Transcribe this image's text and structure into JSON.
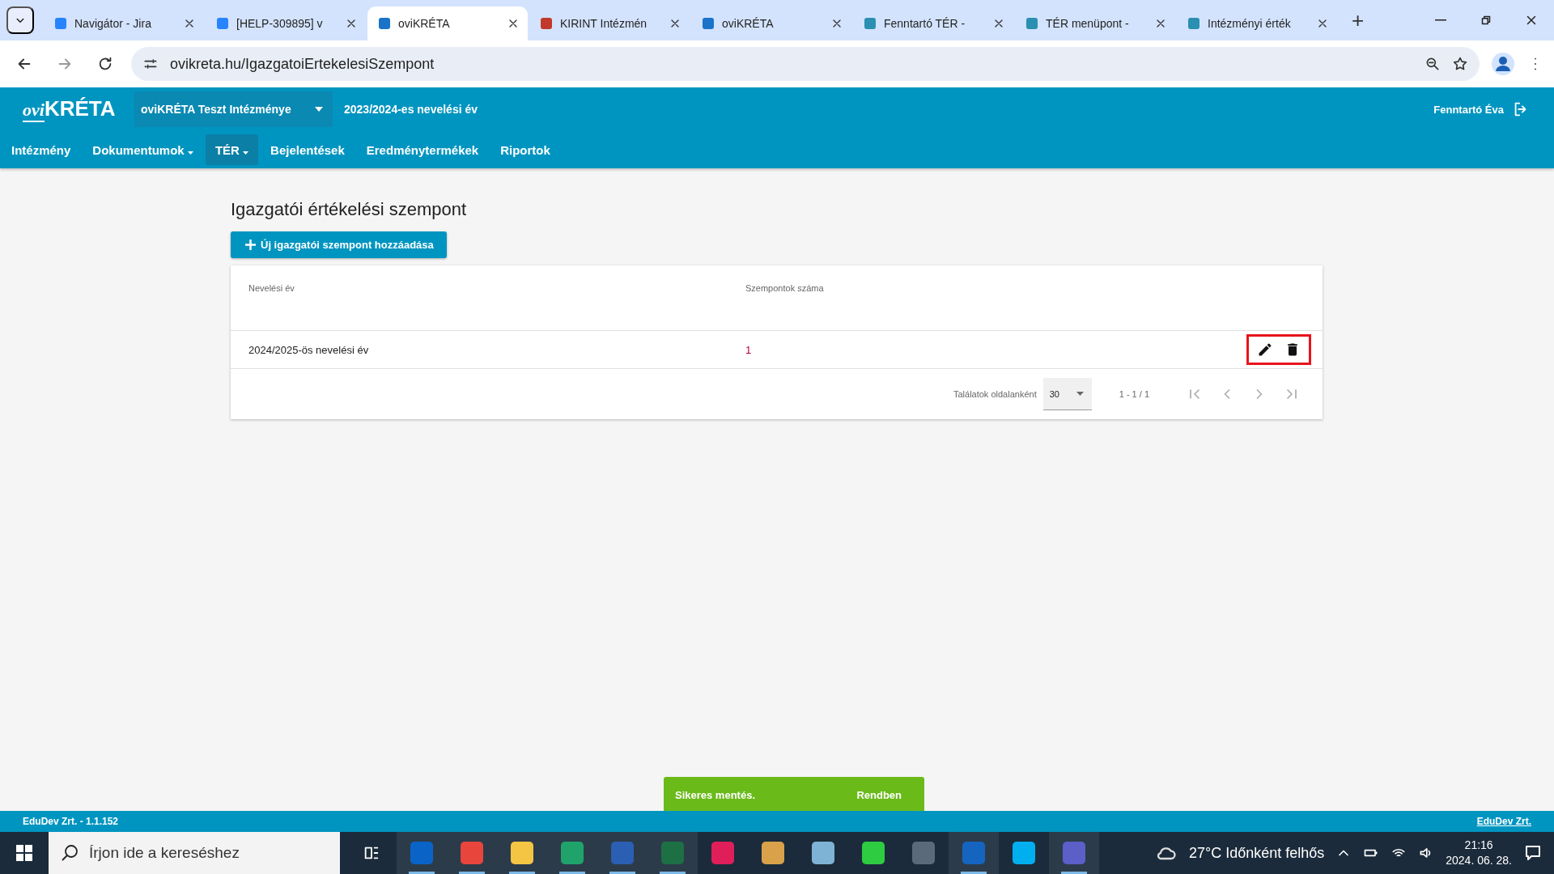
{
  "browser": {
    "tabs": [
      {
        "title": "Navigátor - Jira",
        "selected": false,
        "color": "#2684ff"
      },
      {
        "title": "[HELP-309895] v",
        "selected": false,
        "color": "#2684ff"
      },
      {
        "title": "oviKRÉTA",
        "selected": true,
        "color": "#1a73c8"
      },
      {
        "title": "KIRINT Intézmén",
        "selected": false,
        "color": "#c0392b"
      },
      {
        "title": "oviKRÉTA",
        "selected": false,
        "color": "#1a73c8"
      },
      {
        "title": "Fenntartó TÉR -",
        "selected": false,
        "color": "#2a8fb0"
      },
      {
        "title": "TÉR menüpont -",
        "selected": false,
        "color": "#2a8fb0"
      },
      {
        "title": "Intézményi érték",
        "selected": false,
        "color": "#2a8fb0"
      }
    ],
    "new_tab": "+",
    "url": "ovikreta.hu/IgazgatoiErtekelesiSzempont"
  },
  "header": {
    "logo_prefix": "ovi",
    "logo_main": "KRÉTA",
    "institution": "oviKRÉTA Teszt Intézménye",
    "school_year": "2023/2024-es nevelési év",
    "user": "Fenntartó Éva"
  },
  "nav": [
    {
      "label": "Intézmény",
      "dropdown": false,
      "selected": false
    },
    {
      "label": "Dokumentumok",
      "dropdown": true,
      "selected": false
    },
    {
      "label": "TÉR",
      "dropdown": true,
      "selected": true
    },
    {
      "label": "Bejelentések",
      "dropdown": false,
      "selected": false
    },
    {
      "label": "Eredménytermékek",
      "dropdown": false,
      "selected": false
    },
    {
      "label": "Riportok",
      "dropdown": false,
      "selected": false
    }
  ],
  "page": {
    "title": "Igazgatói értékelési szempont",
    "add_button": "Új igazgatói szempont hozzáadása"
  },
  "table": {
    "columns": [
      "Nevelési év",
      "Szempontok száma"
    ],
    "rows": [
      {
        "cells": [
          "2024/2025-ös nevelési év",
          "1"
        ],
        "highlighted": true
      }
    ],
    "paging": {
      "label": "Találatok oldalanként",
      "page_size": "30",
      "range": "1 - 1 / 1"
    }
  },
  "toast": {
    "message": "Sikeres mentés.",
    "action": "Rendben"
  },
  "footer": {
    "version": "EduDev Zrt. - 1.1.152",
    "link": "EduDev Zrt."
  },
  "taskbar": {
    "search_placeholder": "Írjon ide a kereséshez",
    "apps": [
      {
        "color": "#0a64c8",
        "open": true
      },
      {
        "color": "#e8453c",
        "open": true
      },
      {
        "color": "#f4c542",
        "open": true
      },
      {
        "color": "#1fa36b",
        "open": true
      },
      {
        "color": "#2b5fb4",
        "open": true
      },
      {
        "color": "#1d7044",
        "open": true
      },
      {
        "color": "#e01e5a",
        "open": false
      },
      {
        "color": "#d9a24a",
        "open": false
      },
      {
        "color": "#7fb3d5",
        "open": false
      },
      {
        "color": "#2ecc40",
        "open": false
      },
      {
        "color": "#5a6a7a",
        "open": false
      },
      {
        "color": "#1565c0",
        "open": true
      },
      {
        "color": "#00aff0",
        "open": false
      },
      {
        "color": "#5b5fc7",
        "open": true
      }
    ],
    "weather": "27°C  Időnként felhős",
    "time": "21:16",
    "date": "2024. 06. 28."
  }
}
